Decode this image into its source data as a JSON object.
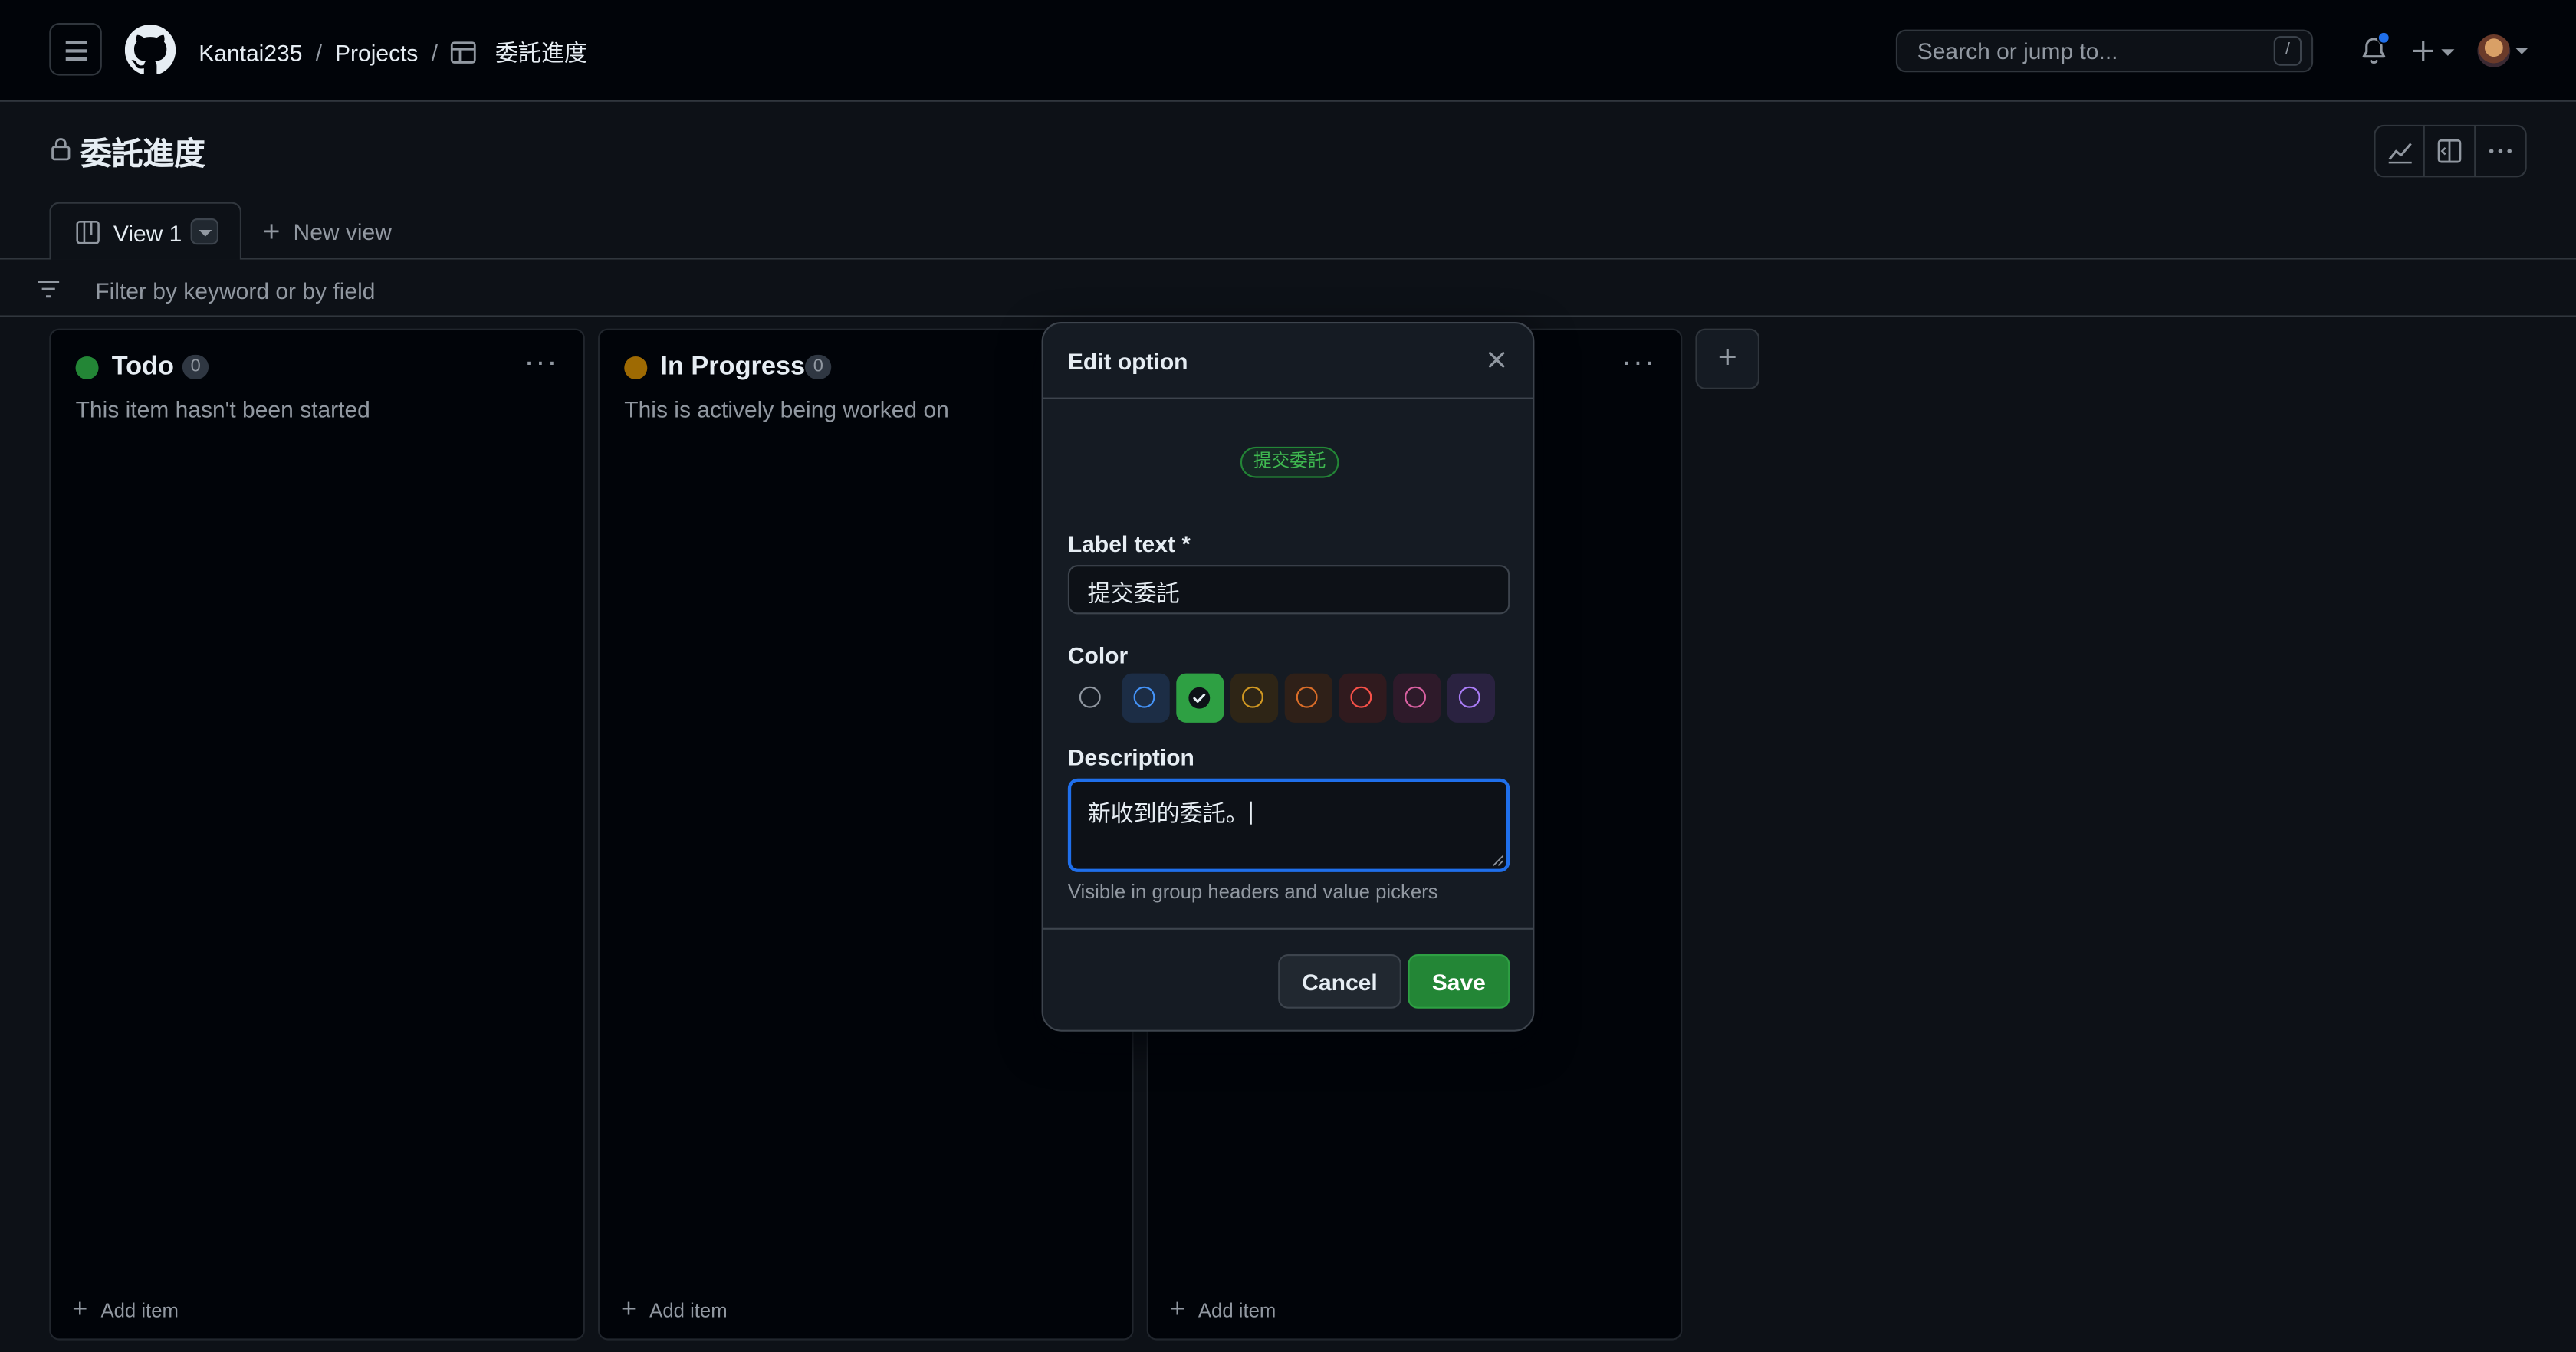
{
  "header": {
    "breadcrumb": {
      "owner": "Kantai235",
      "projects": "Projects",
      "project": "委託進度",
      "separator": "/"
    },
    "search": {
      "placeholder": "Search or jump to...",
      "shortcut": "/"
    },
    "icons": [
      "hamburger-icon",
      "github-logo",
      "table-icon",
      "bell-icon",
      "plus-icon",
      "avatar"
    ]
  },
  "project": {
    "title": "委託進度",
    "toolbar_icons": [
      "insights-icon",
      "side-panel-icon",
      "kebab-icon"
    ]
  },
  "views": {
    "tabs": [
      {
        "label": "View 1",
        "icon": "board-icon"
      }
    ],
    "new_view_label": "New view"
  },
  "filter": {
    "placeholder": "Filter by keyword or by field"
  },
  "columns": [
    {
      "title": "Todo",
      "count": "0",
      "description": "This item hasn't been started",
      "color": "#238636",
      "add_label": "Add item"
    },
    {
      "title": "In Progress",
      "count": "0",
      "description": "This is actively being worked on",
      "color": "#9e6a03",
      "add_label": "Add item"
    },
    {
      "title": "",
      "count": "",
      "description": "",
      "color": "",
      "add_label": "Add item"
    }
  ],
  "modal": {
    "title": "Edit option",
    "preview_label": "提交委託",
    "label_field": {
      "label": "Label text *",
      "value": "提交委託"
    },
    "color_field": {
      "label": "Color",
      "options": [
        {
          "name": "gray",
          "ring": "#9198a1",
          "bg": "transparent",
          "selected": false
        },
        {
          "name": "blue",
          "ring": "#4493f8",
          "bg": "#1c2d45",
          "selected": false
        },
        {
          "name": "green",
          "ring": "#3fb950",
          "bg": "#2ea043",
          "selected": true
        },
        {
          "name": "yellow",
          "ring": "#d29922",
          "bg": "#2e2516",
          "selected": false
        },
        {
          "name": "orange",
          "ring": "#db6d28",
          "bg": "#2f2018",
          "selected": false
        },
        {
          "name": "red",
          "ring": "#f85149",
          "bg": "#301a1e",
          "selected": false
        },
        {
          "name": "pink",
          "ring": "#db61a2",
          "bg": "#2e1a2a",
          "selected": false
        },
        {
          "name": "purple",
          "ring": "#ab7df8",
          "bg": "#2a2240",
          "selected": false
        }
      ]
    },
    "description_field": {
      "label": "Description",
      "value": "新收到的委託。",
      "hint": "Visible in group headers and value pickers"
    },
    "cancel_label": "Cancel",
    "save_label": "Save"
  },
  "colors": {
    "background": "#0d1117",
    "header_bg": "#010409",
    "accent": "#1f6feb",
    "success": "#238636"
  }
}
